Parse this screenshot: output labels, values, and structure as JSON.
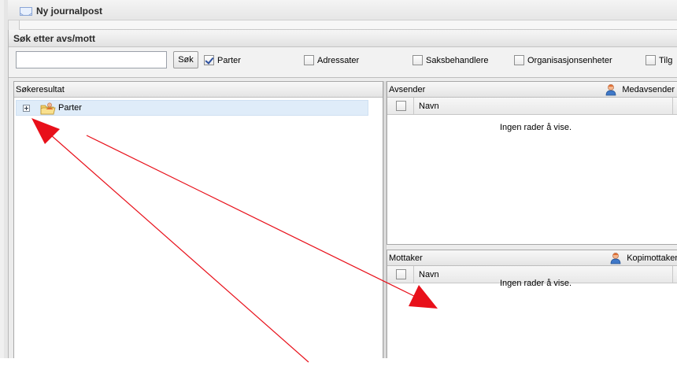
{
  "background_window": {
    "title": "Ny journalpost",
    "icon": "mail-icon"
  },
  "dialog": {
    "title": "Søk etter avs/mott"
  },
  "search": {
    "input_value": "",
    "button_label": "Søk",
    "filters": [
      {
        "label": "Parter",
        "checked": true
      },
      {
        "label": "Adressater",
        "checked": false
      },
      {
        "label": "Saksbehandlere",
        "checked": false
      },
      {
        "label": "Organisasjonsenheter",
        "checked": false
      },
      {
        "label": "Tilg",
        "checked": false
      }
    ]
  },
  "results_panel": {
    "title": "Søkeresultat",
    "tree": [
      {
        "label": "Parter",
        "icon": "folder-person-icon",
        "expanded": false
      }
    ]
  },
  "sender_panel": {
    "title": "Avsender",
    "action_label": "Medavsender",
    "action_icon": "person-icon",
    "column": "Navn",
    "empty_text": "Ingen rader å vise."
  },
  "recipient_panel": {
    "title": "Mottaker",
    "action_label": "Kopimottaker",
    "action_icon": "person-icon",
    "column": "Navn",
    "empty_text": "Ingen rader å vise."
  },
  "annotation_color": "#e8101a"
}
